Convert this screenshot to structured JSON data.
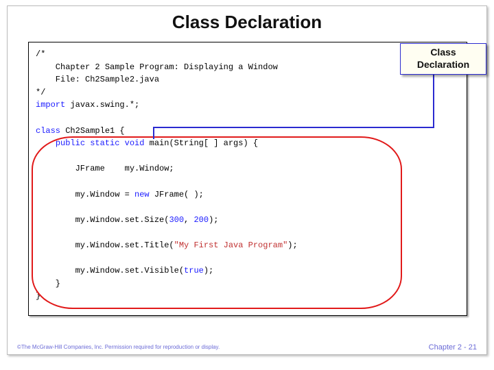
{
  "title": "Class Declaration",
  "callout": {
    "line1": "Class",
    "line2": "Declaration"
  },
  "footer": {
    "left": "©The McGraw-Hill Companies, Inc. Permission required for reproduction or display.",
    "right": "Chapter 2 - 21"
  },
  "code": {
    "c1": "/*",
    "c2": "    Chapter 2 Sample Program: Displaying a Window",
    "c3": "",
    "c4": "    File: Ch2Sample2.java",
    "c5": "*/",
    "c6": "",
    "imp_kw": "import",
    "imp_rest": " javax.swing.*;",
    "cls_kw": "class",
    "cls_rest": " Ch2Sample1 {",
    "main1": "public static void",
    "main2": " main(String[ ] args) {",
    "l1a": "        JFrame    my.Window;",
    "l2a": "        my.Window = ",
    "l2_new": "new",
    "l2b": " JFrame( );",
    "l3a": "        my.Window.set.Size(",
    "l3_n1": "300",
    "l3_mid": ", ",
    "l3_n2": "200",
    "l3b": ");",
    "l4a": "        my.Window.set.Title(",
    "l4_str": "\"My First Java Program\"",
    "l4b": ");",
    "l5a": "        my.Window.set.Visible(",
    "l5_bool": "true",
    "l5b": ");",
    "l6": "    }",
    "l7": "}"
  }
}
